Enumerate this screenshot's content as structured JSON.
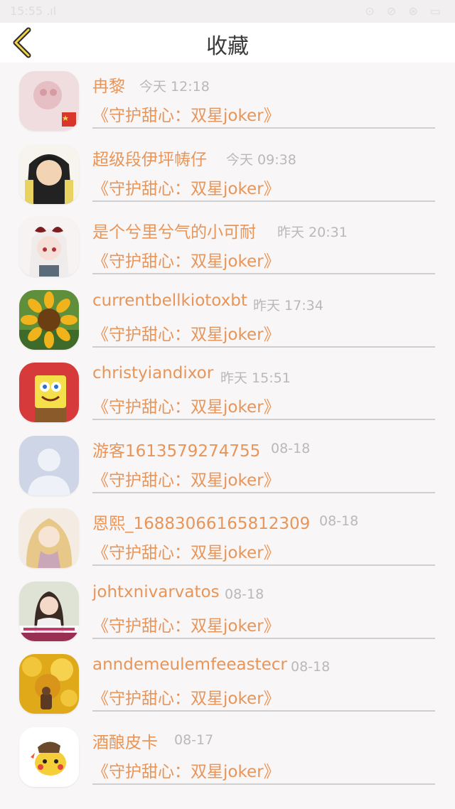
{
  "status": {
    "time": "15:55 .ıl",
    "right": "⊙ ⊘ ⊛ ▭"
  },
  "header": {
    "title": "收藏"
  },
  "items": [
    {
      "name": "冉黎",
      "time": "今天 12:18",
      "book": "《守护甜心：双星joker》",
      "avatar": "avatar-pink-photo"
    },
    {
      "name": "超级段伊坪帱仔",
      "time": "今天 09:38",
      "book": "《守护甜心：双星joker》",
      "avatar": "avatar-anime-boy"
    },
    {
      "name": "是个兮里兮气的小可耐",
      "time": "昨天 20:31",
      "book": "《守护甜心：双星joker》",
      "avatar": "avatar-anime-girl"
    },
    {
      "name": "currentbellkiotoxbt",
      "time": "昨天 17:34",
      "book": "《守护甜心：双星joker》",
      "avatar": "avatar-sunflower"
    },
    {
      "name": "christyiandixor",
      "time": "昨天 15:51",
      "book": "《守护甜心：双星joker》",
      "avatar": "avatar-spongebob"
    },
    {
      "name": "游客1613579274755",
      "time": "08-18",
      "book": "《守护甜心：双星joker》",
      "avatar": "avatar-default-user"
    },
    {
      "name": "恩熙_16883066165812309",
      "time": "08-18",
      "book": "《守护甜心：双星joker》",
      "avatar": "avatar-illustrated-girl"
    },
    {
      "name": "johtxnivarvatos",
      "time": "08-18",
      "book": "《守护甜心：双星joker》",
      "avatar": "avatar-girl-photo"
    },
    {
      "name": "anndemeulemfeeastecr",
      "time": "08-18",
      "book": "《守护甜心：双星joker》",
      "avatar": "avatar-yellow-leaves"
    },
    {
      "name": "酒酿皮卡",
      "time": "08-17",
      "book": "《守护甜心：双星joker》",
      "avatar": "avatar-pikachu"
    }
  ]
}
